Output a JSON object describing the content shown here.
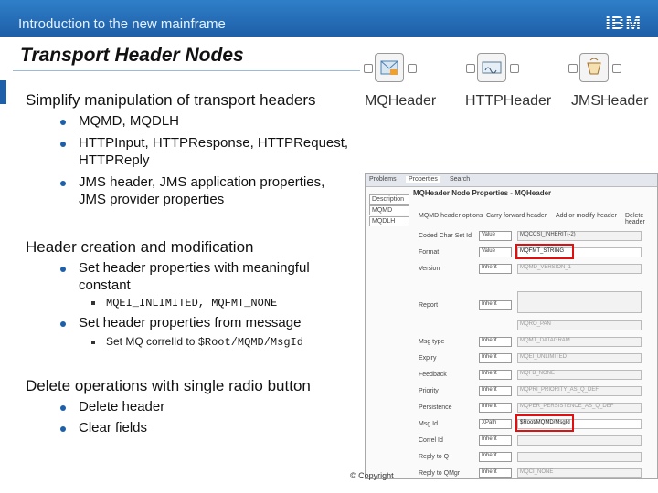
{
  "header": {
    "course_title": "Introduction to the new mainframe",
    "logo": "IBM"
  },
  "slide": {
    "title": "Transport Header Nodes"
  },
  "nodes": [
    {
      "label": "MQHeader",
      "icon": "mq-envelope-icon"
    },
    {
      "label": "HTTPHeader",
      "icon": "http-signal-icon"
    },
    {
      "label": "JMSHeader",
      "icon": "jms-cup-icon"
    }
  ],
  "sections": [
    {
      "heading": "Simplify manipulation of transport headers",
      "bullets": [
        "MQMD, MQDLH",
        "HTTPInput, HTTPResponse, HTTPRequest,",
        "HTTPReply",
        "JMS header, JMS application properties,",
        "JMS provider properties"
      ]
    },
    {
      "heading": "Header creation and modification",
      "bullets": [
        "Set header properties with meaningful",
        "constant",
        "Set header properties from message"
      ],
      "sub1": "MQEI_INLIMITED, MQFMT_NONE",
      "sub2_text": "Set MQ correlId to ",
      "sub2_code": "$Root/MQMD/MsgId"
    },
    {
      "heading": "Delete operations with single radio button",
      "bullets": [
        "Delete header",
        "Clear fields"
      ]
    }
  ],
  "panel": {
    "tabs": [
      "Problems",
      "Properties",
      "Search"
    ],
    "title": "MQHeader Node Properties - MQHeader",
    "side": [
      "Description",
      "MQMD",
      "MQDLH"
    ],
    "options_label": "MQMD header options",
    "options": [
      "Carry forward header",
      "Add or modify header",
      "Delete header"
    ],
    "rows": [
      {
        "label": "Coded Char Set Id",
        "mode": "Value",
        "value": "MQCCSI_INHERIT(-2)"
      },
      {
        "label": "Format",
        "mode": "Value",
        "value": "MQFMT_STRING"
      },
      {
        "label": "Version",
        "mode": "Inherit",
        "value": "MQMD_VERSION_1"
      },
      {
        "label": "Report",
        "mode": "Inherit",
        "value": ""
      },
      {
        "label": "",
        "mode": "",
        "value": "MQRO_PAN"
      },
      {
        "label": "Msg type",
        "mode": "Inherit",
        "value": "MQMT_DATAGRAM"
      },
      {
        "label": "Expiry",
        "mode": "Inherit",
        "value": "MQEI_UNLIMITED"
      },
      {
        "label": "Feedback",
        "mode": "Inherit",
        "value": "MQFB_NONE"
      },
      {
        "label": "Priority",
        "mode": "Inherit",
        "value": "MQPRI_PRIORITY_AS_Q_DEF"
      },
      {
        "label": "Persistence",
        "mode": "Inherit",
        "value": "MQPER_PERSISTENCE_AS_Q_DEF"
      },
      {
        "label": "Msg Id",
        "mode": "XPath",
        "value": "$Root/MQMD/MsgId"
      },
      {
        "label": "Correl Id",
        "mode": "Inherit",
        "value": ""
      },
      {
        "label": "Reply to Q",
        "mode": "Inherit",
        "value": ""
      },
      {
        "label": "Reply to QMgr",
        "mode": "Inherit",
        "value": "MQCI_NONE"
      }
    ]
  },
  "footer": {
    "copyright": "© Copyright"
  }
}
